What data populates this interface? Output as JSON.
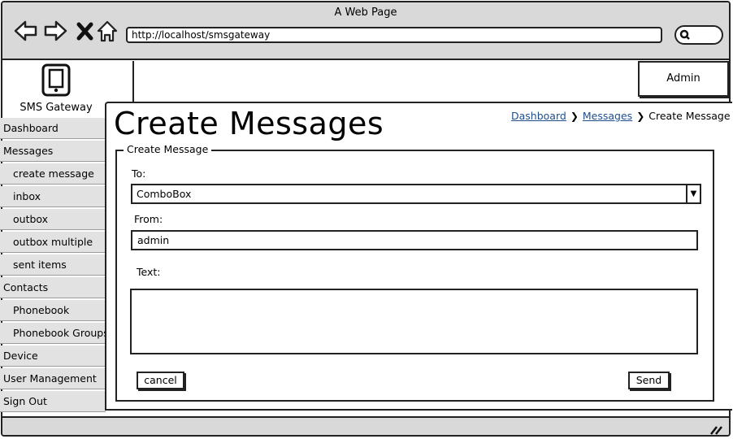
{
  "window": {
    "title": "A Web Page"
  },
  "browser": {
    "url": "http://localhost/smsgateway",
    "nav_icons": [
      "back-arrow-icon",
      "forward-arrow-icon",
      "close-x-icon",
      "home-icon"
    ],
    "search_icon": "search-icon"
  },
  "header": {
    "admin_label": "Admin"
  },
  "brand": {
    "name": "SMS Gateway",
    "icon": "mobile-phone-icon"
  },
  "sidebar": {
    "items": [
      {
        "label": "Dashboard"
      },
      {
        "label": "Messages"
      },
      {
        "label": "create message"
      },
      {
        "label": "inbox"
      },
      {
        "label": "outbox"
      },
      {
        "label": "outbox multiple"
      },
      {
        "label": "sent items"
      },
      {
        "label": "Contacts"
      },
      {
        "label": "Phonebook"
      },
      {
        "label": "Phonebook Groups"
      },
      {
        "label": "Device"
      },
      {
        "label": "User Management"
      },
      {
        "label": "Sign Out"
      }
    ]
  },
  "page": {
    "title": "Create Messages"
  },
  "breadcrumb": {
    "link1": "Dashboard",
    "link2": "Messages",
    "current": "Create Message"
  },
  "form": {
    "legend": "Create Message",
    "to_label": "To:",
    "to_value": "ComboBox",
    "from_label": "From:",
    "from_value": "admin",
    "text_label": "Text:",
    "text_value": "",
    "cancel_label": "cancel",
    "send_label": "Send"
  },
  "colors": {
    "chrome": "#d9d9d9",
    "sidebar_bg": "#e2e2e2",
    "link": "#1f4e8c"
  }
}
